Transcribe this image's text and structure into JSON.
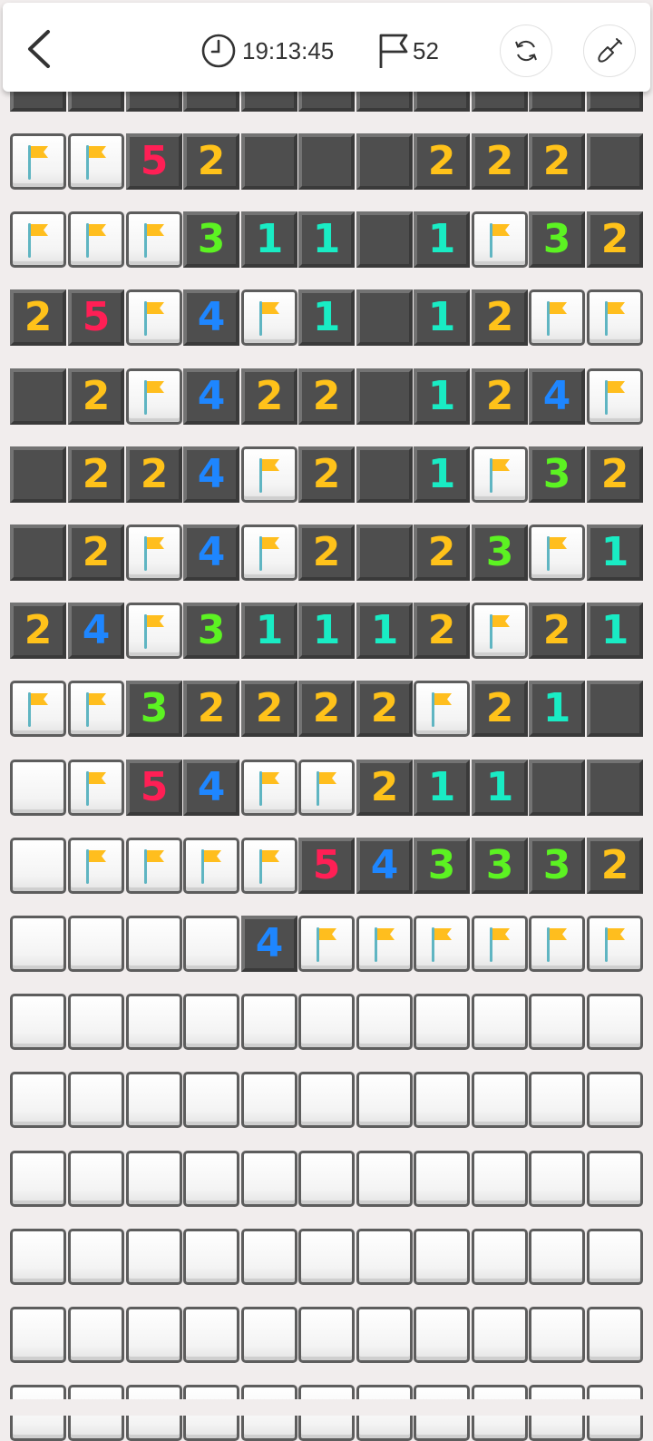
{
  "header": {
    "timer_text": "19:13:45",
    "flag_count_text": "52"
  },
  "icons": {
    "back": "chevron-left-icon",
    "timer": "clock-icon",
    "flags": "flag-outline-icon",
    "restart": "refresh-icon",
    "tool": "shovel-icon",
    "cell_flag": "flag-icon"
  },
  "colors": {
    "1": "#19ecc4",
    "2": "#ffc21a",
    "3": "#5cf222",
    "4": "#1e86ff",
    "5": "#ff1f55",
    "flag": "#ffbe1e",
    "revealed_bg": "#4e4e4e",
    "page_bg": "#f1eded"
  },
  "board": {
    "rows": [
      "FF52...222.",
      "FFF311.1F32",
      "25F4F1.12FF",
      ".2F422.124F",
      ".224F2.1F32",
      ".2F4F2.23F1",
      "24F31112F21",
      "FF32222F21.",
      "HF54FF211..",
      "HFFFF543332",
      "HHHH4FFFFFF",
      "HHHHHHHHHHH",
      "HHHHHHHHHHH",
      "HHHHHHHHHHH",
      "HHHHHHHHHHH",
      "HHHHHHHHHHH"
    ]
  }
}
